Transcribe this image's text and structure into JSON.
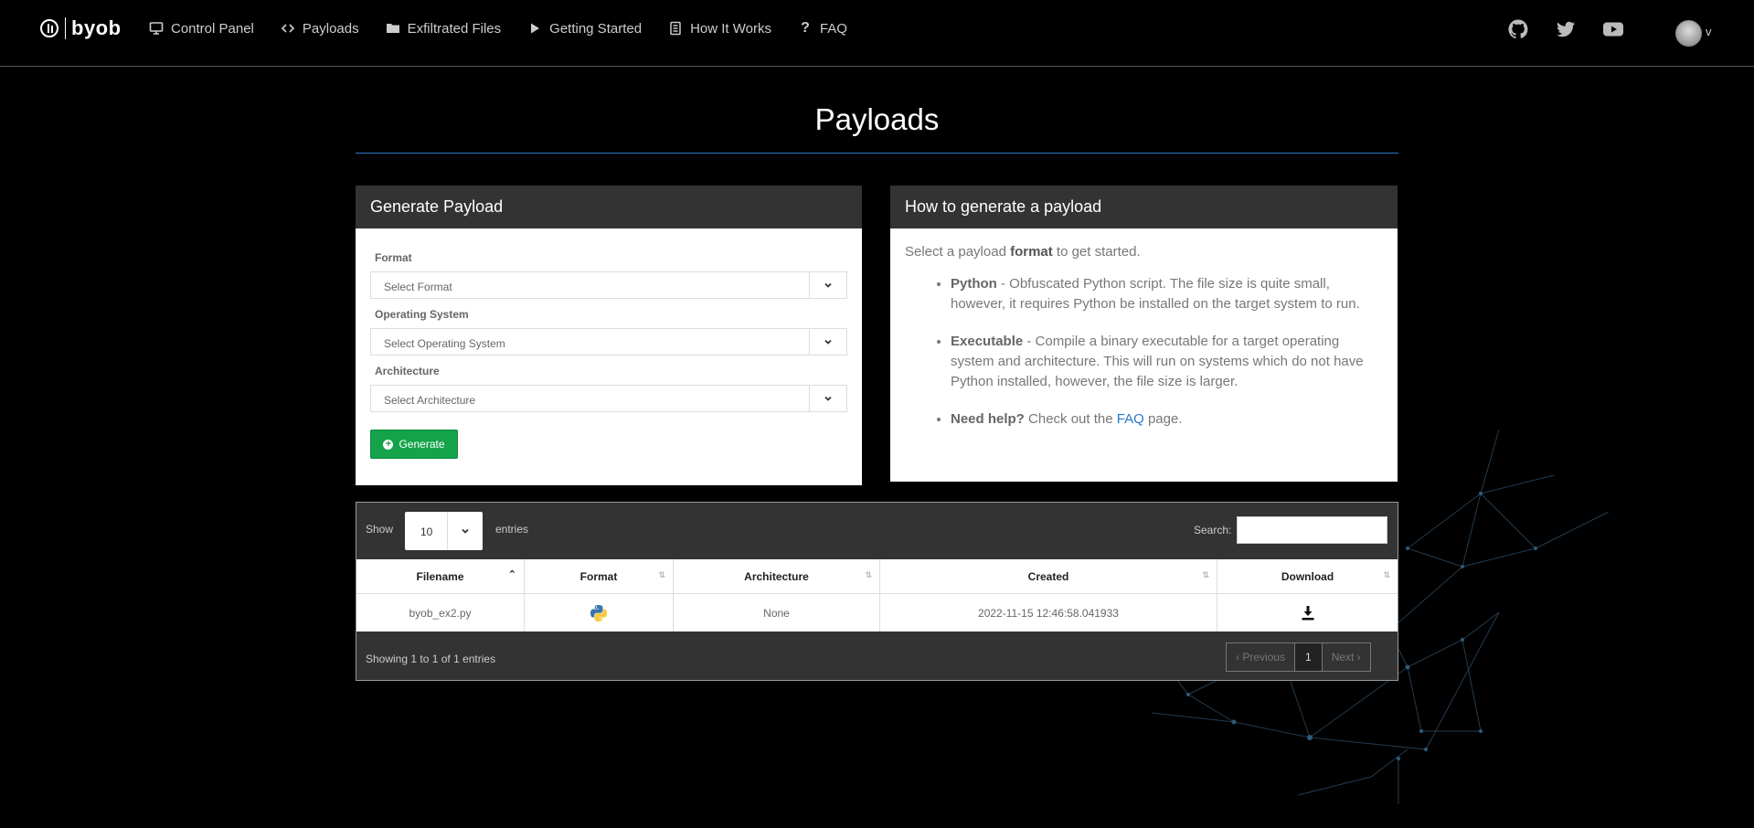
{
  "brand": {
    "name": "byob"
  },
  "nav": {
    "items": [
      {
        "label": "Control Panel",
        "icon": "monitor-icon"
      },
      {
        "label": "Payloads",
        "icon": "code-icon"
      },
      {
        "label": "Exfiltrated Files",
        "icon": "folder-icon"
      },
      {
        "label": "Getting Started",
        "icon": "play-icon"
      },
      {
        "label": "How It Works",
        "icon": "document-icon"
      },
      {
        "label": "FAQ",
        "icon": "question-icon"
      }
    ],
    "social": [
      "github-icon",
      "twitter-icon",
      "youtube-icon"
    ],
    "user_initial": "v"
  },
  "page": {
    "title": "Payloads"
  },
  "generate_panel": {
    "title": "Generate Payload",
    "format_label": "Format",
    "format_placeholder": "Select Format",
    "os_label": "Operating System",
    "os_placeholder": "Select Operating System",
    "arch_label": "Architecture",
    "arch_placeholder": "Select Architecture",
    "button_label": "Generate"
  },
  "how_panel": {
    "title": "How to generate a payload",
    "intro_pre": "Select a payload ",
    "intro_bold": "format",
    "intro_post": " to get started.",
    "python_title": "Python",
    "python_text": " - Obfuscated Python script. The file size is quite small, however, it requires Python be installed on the target system to run.",
    "exe_title": "Executable",
    "exe_text": " - Compile a binary executable for a target operating system and architecture. This will run on systems which do not have Python installed, however, the file size is larger.",
    "help_title": "Need help?",
    "help_pre": " Check out the ",
    "help_link": "FAQ",
    "help_post": " page."
  },
  "table": {
    "show_label": "Show",
    "entries_value": "10",
    "entries_label": "entries",
    "search_label": "Search:",
    "columns": [
      "Filename",
      "Format",
      "Architecture",
      "Created",
      "Download"
    ],
    "rows": [
      {
        "filename": "byob_ex2.py",
        "format_icon": "python-icon",
        "architecture": "None",
        "created": "2022-11-15 12:46:58.041933",
        "download_icon": "download-icon"
      }
    ],
    "showing": "Showing 1 to 1 of 1 entries",
    "pager": {
      "previous": "Previous",
      "current": "1",
      "next": "Next"
    }
  },
  "colors": {
    "accent": "#2a78c9",
    "generate_button": "#14a34a",
    "panel_header": "#333333",
    "background": "#000000"
  }
}
